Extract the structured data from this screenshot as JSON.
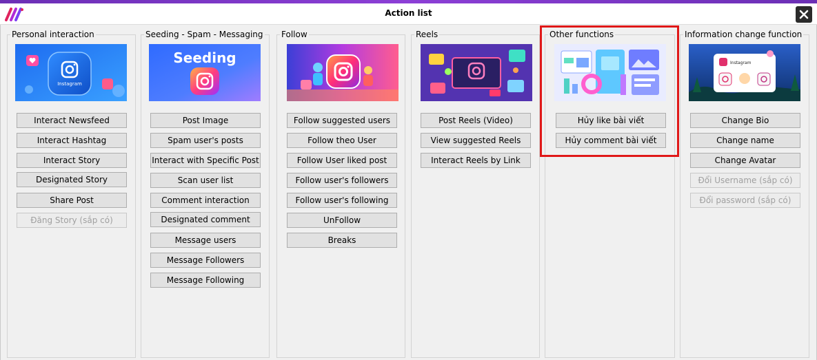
{
  "window": {
    "title": "Action list"
  },
  "groups": [
    {
      "title": "Personal interaction",
      "thumb_text": "Instagram",
      "buttons": [
        {
          "label": "Interact Newsfeed",
          "enabled": true
        },
        {
          "label": "Interact Hashtag",
          "enabled": true
        },
        {
          "label": "Interact Story",
          "enabled": true
        },
        {
          "label": "Designated Story",
          "enabled": true
        },
        {
          "label": "Share Post",
          "enabled": true
        },
        {
          "label": "Đăng Story (sắp có)",
          "enabled": false
        }
      ]
    },
    {
      "title": "Seeding - Spam - Messaging",
      "thumb_text": "Seeding",
      "buttons": [
        {
          "label": "Post Image",
          "enabled": true
        },
        {
          "label": "Spam user's posts",
          "enabled": true
        },
        {
          "label": "Interact with Specific Post",
          "enabled": true
        },
        {
          "label": "Scan user list",
          "enabled": true
        },
        {
          "label": "Comment interaction",
          "enabled": true
        },
        {
          "label": "Designated comment",
          "enabled": true
        },
        {
          "label": "Message users",
          "enabled": true
        },
        {
          "label": "Message Followers",
          "enabled": true
        },
        {
          "label": "Message Following",
          "enabled": true
        }
      ]
    },
    {
      "title": "Follow",
      "buttons": [
        {
          "label": "Follow suggested users",
          "enabled": true
        },
        {
          "label": "Follow theo User",
          "enabled": true
        },
        {
          "label": "Follow User liked post",
          "enabled": true
        },
        {
          "label": "Follow user's followers",
          "enabled": true
        },
        {
          "label": "Follow user's following",
          "enabled": true
        },
        {
          "label": "UnFollow",
          "enabled": true
        },
        {
          "label": "Breaks",
          "enabled": true
        }
      ]
    },
    {
      "title": "Reels",
      "buttons": [
        {
          "label": "Post Reels (Video)",
          "enabled": true
        },
        {
          "label": "View suggested Reels",
          "enabled": true
        },
        {
          "label": "Interact Reels by Link",
          "enabled": true
        }
      ]
    },
    {
      "title": "Other functions",
      "buttons": [
        {
          "label": "Hủy like bài viết",
          "enabled": true
        },
        {
          "label": "Hủy comment bài viết",
          "enabled": true
        }
      ]
    },
    {
      "title": "Information change function",
      "thumb_text": "Instagram",
      "buttons": [
        {
          "label": "Change Bio",
          "enabled": true
        },
        {
          "label": "Change name",
          "enabled": true
        },
        {
          "label": "Change Avatar",
          "enabled": true
        },
        {
          "label": "Đổi Username (sắp có)",
          "enabled": false
        },
        {
          "label": "Đổi password (sắp có)",
          "enabled": false
        }
      ]
    }
  ],
  "icons": {
    "app_logo": "app-logo-icon",
    "close": "close-icon"
  },
  "colors": {
    "accent_strip": "#6b2fb5",
    "highlight_border": "#e01818",
    "button_face": "#e1e1e1",
    "disabled_text": "#a0a0a0"
  }
}
